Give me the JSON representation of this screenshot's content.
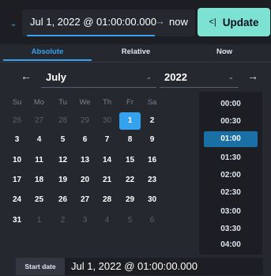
{
  "header": {
    "start": "Jul 1, 2022 @ 01:00:00.000",
    "arrow_icon": "arrow-right",
    "end": "now",
    "update_label": "Update",
    "update_icon": "refresh-icon"
  },
  "tabs": [
    "Absolute",
    "Relative",
    "Now"
  ],
  "active_tab": "Absolute",
  "calendar": {
    "month": "July",
    "year": "2022",
    "weekdays": [
      "Su",
      "Mo",
      "Tu",
      "We",
      "Th",
      "Fr",
      "Sa"
    ],
    "weeks": [
      [
        "26",
        "27",
        "28",
        "29",
        "30",
        "1",
        "2"
      ],
      [
        "3",
        "4",
        "5",
        "6",
        "7",
        "8",
        "9"
      ],
      [
        "10",
        "11",
        "12",
        "13",
        "14",
        "15",
        "16"
      ],
      [
        "17",
        "18",
        "19",
        "20",
        "21",
        "22",
        "23"
      ],
      [
        "24",
        "25",
        "26",
        "27",
        "28",
        "29",
        "30"
      ],
      [
        "31",
        "1",
        "2",
        "3",
        "4",
        "5",
        "6"
      ]
    ],
    "selected_day": "1"
  },
  "times": [
    "00:00",
    "00:30",
    "01:00",
    "01:30",
    "02:00",
    "02:30",
    "03:00",
    "03:30",
    "04:00"
  ],
  "selected_time": "01:00",
  "start_date": {
    "label": "Start date",
    "value": "Jul 1, 2022 @ 01:00:00.000"
  },
  "colors": {
    "accent": "#36a2ef",
    "update_button": "#7de2d1",
    "background": "#1d1e24",
    "panel": "#25282f"
  }
}
